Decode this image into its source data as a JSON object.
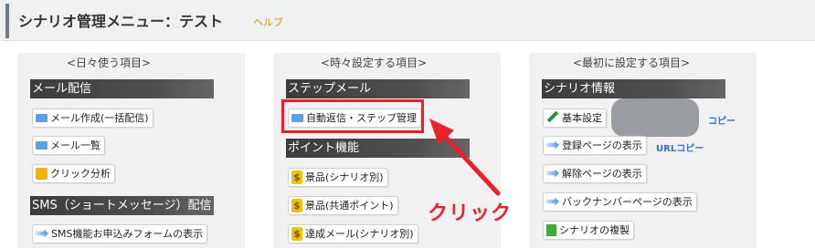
{
  "header": {
    "title": "シナリオ管理メニュー：テスト",
    "help": "ヘルプ"
  },
  "columns": [
    {
      "heading": "<日々使う項目>",
      "sections": [
        {
          "title": "メール配信",
          "items": [
            "メール作成(一括配信)",
            "メール一覧",
            "クリック分析"
          ]
        },
        {
          "title": "SMS（ショートメッセージ）配信",
          "items": [
            "SMS機能お申込みフォームの表示"
          ]
        }
      ]
    },
    {
      "heading": "<時々設定する項目>",
      "sections": [
        {
          "title": "ステップメール",
          "items": [
            "自動返信・ステップ管理"
          ]
        },
        {
          "title": "ポイント機能",
          "items": [
            "景品(シナリオ別)",
            "景品(共通ポイント)",
            "達成メール(シナリオ別)"
          ]
        }
      ]
    },
    {
      "heading": "<最初に設定する項目>",
      "sections": [
        {
          "title": "シナリオ情報",
          "items": [
            "基本設定",
            "登録ページの表示",
            "解除ページの表示",
            "バックナンバーページの表示",
            "シナリオの複製"
          ]
        }
      ],
      "links": {
        "copy": "コピー",
        "url_copy": "URLコピー"
      }
    }
  ],
  "annotation": {
    "label": "クリック",
    "color": "#e8222a"
  },
  "colors": {
    "help": "#d4a100",
    "link": "#2f6fd6",
    "section_bg": "#3c3c3c"
  }
}
